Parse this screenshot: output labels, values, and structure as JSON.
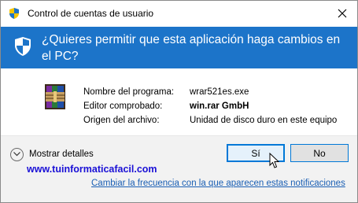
{
  "window": {
    "title": "Control de cuentas de usuario",
    "close_icon": "close-icon",
    "title_icon": "uac-shield-icon"
  },
  "banner": {
    "question": "¿Quieres permitir que esta aplicación haga cambios en el PC?",
    "color": "#1c74c9",
    "icon": "uac-shield-icon"
  },
  "program": {
    "icon": "winrar-books-icon",
    "rows": [
      {
        "label": "Nombre del programa:",
        "value": "wrar521es.exe",
        "bold": false
      },
      {
        "label": "Editor comprobado:",
        "value": "win.rar GmbH",
        "bold": true
      },
      {
        "label": "Origen del archivo:",
        "value": "Unidad de disco duro en este equipo",
        "bold": false
      }
    ]
  },
  "footer": {
    "details_label": "Mostrar detalles",
    "yes_label": "Sí",
    "no_label": "No",
    "watermark": "www.tuinformaticafacil.com",
    "link": "Cambiar la frecuencia con la que aparecen estas notificaciones"
  }
}
